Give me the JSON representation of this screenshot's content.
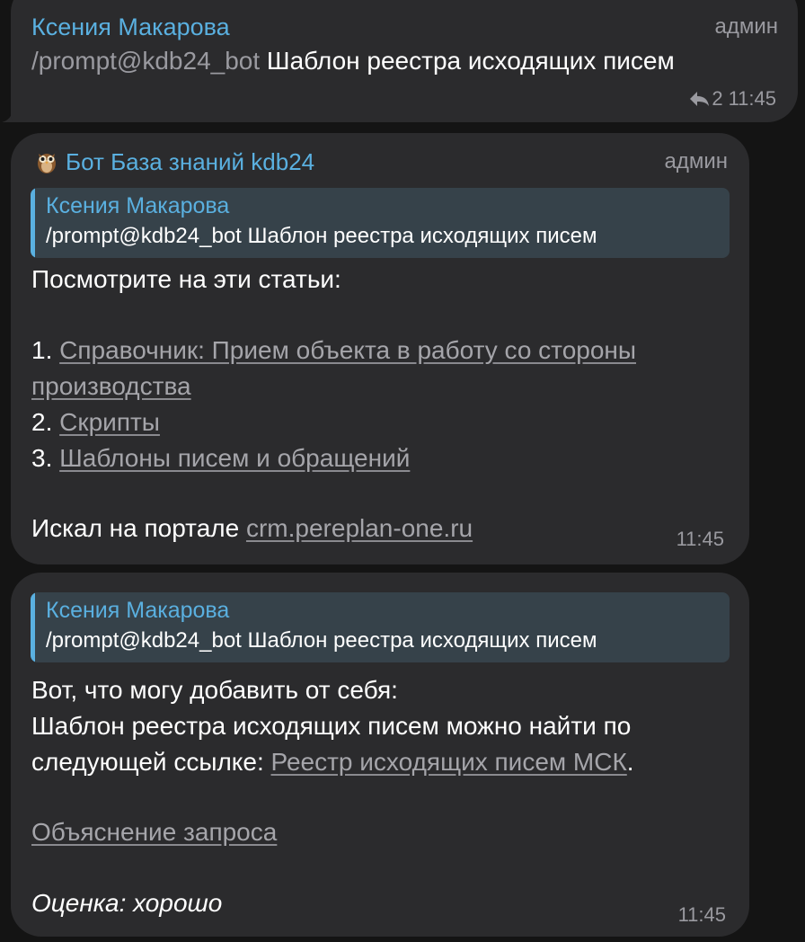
{
  "messages": [
    {
      "sender": "Ксения Макарова",
      "role": "админ",
      "command": "/prompt@kdb24_bot",
      "text": "Шаблон реестра исходящих писем",
      "reply_count": "2",
      "time": "11:45",
      "icons": [
        "reply-arrow-icon"
      ]
    },
    {
      "sender_emoji": "owl-icon",
      "sender": "Бот База знаний kdb24",
      "role": "админ",
      "reply": {
        "name": "Ксения Макарова",
        "text": "/prompt@kdb24_bot Шаблон реестра исходящих писем"
      },
      "intro": "Посмотрите на эти статьи:",
      "items": [
        {
          "num": "1.",
          "link_line1": "Справочник: Прием объекта в работу со стороны",
          "link_line2": "производства"
        },
        {
          "num": "2.",
          "link": "Скрипты"
        },
        {
          "num": "3.",
          "link": "Шаблоны писем и обращений"
        }
      ],
      "search_prefix": "Искал на портале",
      "search_link": "crm.pereplan-one.ru",
      "time": "11:45"
    },
    {
      "reply": {
        "name": "Ксения Макарова",
        "text": "/prompt@kdb24_bot Шаблон реестра исходящих писем"
      },
      "line1": "Вот, что могу добавить от себя:",
      "line2": "Шаблон реестра исходящих писем можно найти по",
      "line3_prefix": "следующей ссылке:",
      "line3_link": "Реестр исходящих писем МСК",
      "line3_suffix": ".",
      "explain_link": "Объяснение запроса",
      "rating": "Оценка: хорошо",
      "time": "11:45"
    }
  ]
}
